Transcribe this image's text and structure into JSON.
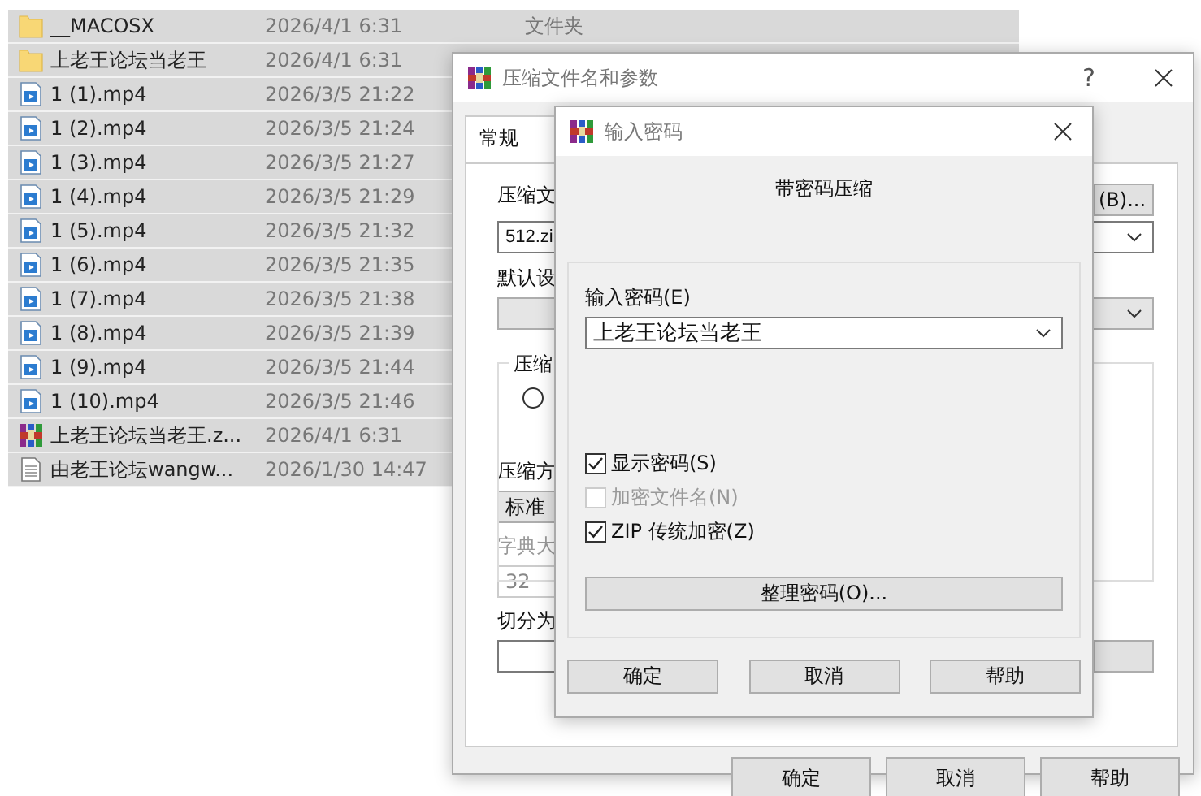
{
  "file_list": {
    "rows": [
      {
        "kind": "folder",
        "name": "__MACOSX",
        "date": "2026/4/1 6:31",
        "type": "文件夹",
        "selected": true
      },
      {
        "kind": "folder",
        "name": "上老王论坛当老王",
        "date": "2026/4/1 6:31",
        "selected": true
      },
      {
        "kind": "video",
        "name": "1 (1).mp4",
        "date": "2026/3/5 21:22",
        "selected": true
      },
      {
        "kind": "video",
        "name": "1 (2).mp4",
        "date": "2026/3/5 21:24",
        "selected": true
      },
      {
        "kind": "video",
        "name": "1 (3).mp4",
        "date": "2026/3/5 21:27",
        "selected": true
      },
      {
        "kind": "video",
        "name": "1 (4).mp4",
        "date": "2026/3/5 21:29",
        "selected": true
      },
      {
        "kind": "video",
        "name": "1 (5).mp4",
        "date": "2026/3/5 21:32",
        "selected": true
      },
      {
        "kind": "video",
        "name": "1 (6).mp4",
        "date": "2026/3/5 21:35",
        "selected": true
      },
      {
        "kind": "video",
        "name": "1 (7).mp4",
        "date": "2026/3/5 21:38",
        "selected": true
      },
      {
        "kind": "video",
        "name": "1 (8).mp4",
        "date": "2026/3/5 21:39",
        "selected": true
      },
      {
        "kind": "video",
        "name": "1 (9).mp4",
        "date": "2026/3/5 21:44",
        "selected": true
      },
      {
        "kind": "video",
        "name": "1 (10).mp4",
        "date": "2026/3/5 21:46",
        "selected": true
      },
      {
        "kind": "archive",
        "name": "上老王论坛当老王.z...",
        "date": "2026/4/1 6:31",
        "selected": true
      },
      {
        "kind": "text",
        "name": "由老王论坛wangw...",
        "date": "2026/1/30 14:47",
        "selected": true
      }
    ]
  },
  "archive_dialog": {
    "title": "压缩文件名和参数",
    "help": "?",
    "tabs": [
      {
        "label": "常规",
        "selected": true
      }
    ],
    "archive_name_label": "压缩文",
    "browse_button": "(B)...",
    "archive_name": "512.zi",
    "profile_label": "默认设",
    "group_label": "压缩",
    "group_radio": {
      "selected": false
    },
    "method_label": "压缩方",
    "method": "标准",
    "dictionary": {
      "label": "字典大",
      "value": "32",
      "disabled": true
    },
    "split_label": "切分为",
    "buttons": [
      "确定",
      "取消",
      "帮助"
    ]
  },
  "password_dialog": {
    "title": "输入密码",
    "heading": "带密码压缩",
    "password_label": "输入密码(E)",
    "password": "上老王论坛当老王",
    "options": [
      {
        "label": "显示密码(S)",
        "checked": true,
        "disabled": false
      },
      {
        "label": "加密文件名(N)",
        "checked": false,
        "disabled": true
      },
      {
        "label": "ZIP 传统加密(Z)",
        "checked": true,
        "disabled": false
      }
    ],
    "organize_button": "整理密码(O)...",
    "buttons": [
      "确定",
      "取消",
      "帮助"
    ]
  }
}
